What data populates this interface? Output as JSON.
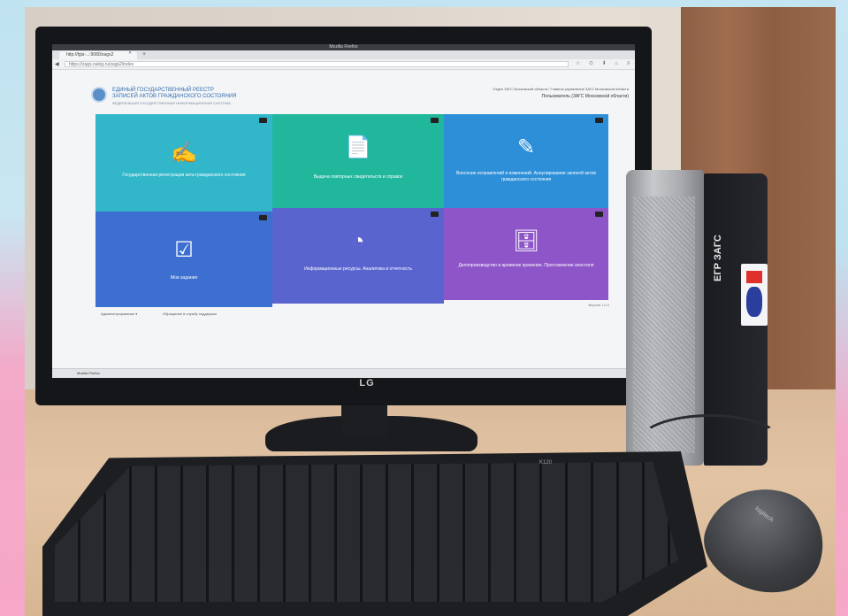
{
  "browser": {
    "window_title": "Mozilla Firefox",
    "tab_label": "http://fgis-...:9080/zags2",
    "tab_close": "✕",
    "new_tab": "+",
    "url": "https://zags.nalog.ru/zags2/index",
    "nav_back": "◀",
    "tool_icons": "☆ ⊙ ⬇ ⌂ ≡"
  },
  "site": {
    "org_line1": "ЕДИНЫЙ ГОСУДАРСТВЕННЫЙ РЕЕСТР",
    "org_line2": "ЗАПИСЕЙ АКТОВ ГРАЖДАНСКОГО СОСТОЯНИЯ",
    "org_line3": "ФЕДЕРАЛЬНАЯ ГОСУДАРСТВЕННАЯ ИНФОРМАЦИОННАЯ СИСТЕМА",
    "location": "Отдел ЗАГС Московской области / Главное управление ЗАГС Московской области",
    "user": "Пользователь (ЗАГС Московской области)"
  },
  "tiles": [
    {
      "label": "Государственная регистрация акта гражданского состояния",
      "icon": "✍"
    },
    {
      "label": "Выдача повторных свидетельств и справок",
      "icon": "📄"
    },
    {
      "label": "Внесение исправлений и изменений. Аннулирование записей актов гражданского состояния",
      "icon": "✎"
    },
    {
      "label": "Мои задания",
      "icon": "☑"
    },
    {
      "label": "Информационные ресурсы. Аналитика и отчетность",
      "icon": "◔"
    },
    {
      "label": "Делопроизводство и архивное хранение. Проставление апостиля",
      "icon": "🗄"
    }
  ],
  "footer": {
    "left": "Администрирование ▾",
    "mid": "Обращение в службу поддержки",
    "version": "Версия 1.0.0"
  },
  "taskbar": {
    "item": "Mozilla Firefox"
  },
  "monitor": {
    "brand": "LG"
  },
  "pc": {
    "label": "ЕГР ЗАГС"
  },
  "keyboard": {
    "brand": "K120"
  },
  "mouse": {
    "brand": "logitech"
  }
}
